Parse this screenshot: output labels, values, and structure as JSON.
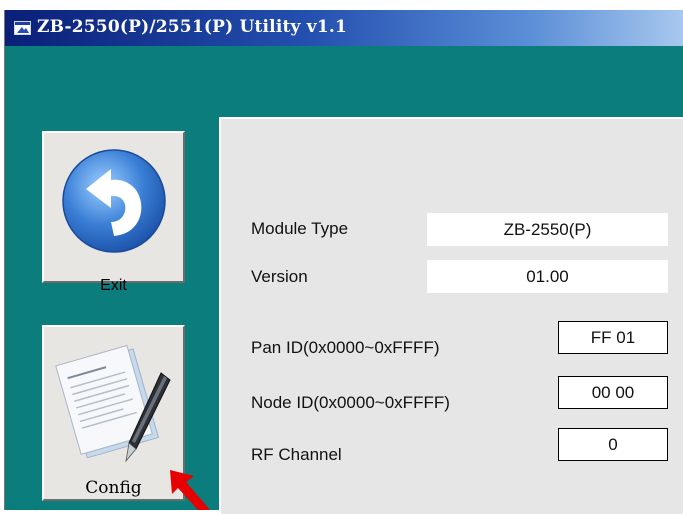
{
  "window": {
    "title": "ZB-2550(P)/2551(P) Utility v1.1",
    "title_icon": "app-window-icon"
  },
  "buttons": {
    "exit": {
      "label": "Exit",
      "icon": "back-arrow-icon"
    },
    "config": {
      "label": "Config",
      "icon": "document-pen-icon"
    }
  },
  "info": {
    "module_type_label": "Module Type",
    "module_type_value": "ZB-2550(P)",
    "version_label": "Version",
    "version_value": "01.00"
  },
  "settings": {
    "pan_id_label": "Pan ID(0x0000~0xFFFF)",
    "pan_id_value": "FF 01",
    "node_id_label": "Node ID(0x0000~0xFFFF)",
    "node_id_value": "00 00",
    "rf_channel_label": "RF Channel",
    "rf_channel_value": "0"
  },
  "colors": {
    "background_teal": "#0b7d7d",
    "panel_gray": "#e6e6e6",
    "title_bar_dark": "#0a1f78",
    "title_bar_light": "#a8c8ee",
    "exit_icon_blue": "#3a7fd6",
    "annotation_arrow": "#e60000"
  }
}
